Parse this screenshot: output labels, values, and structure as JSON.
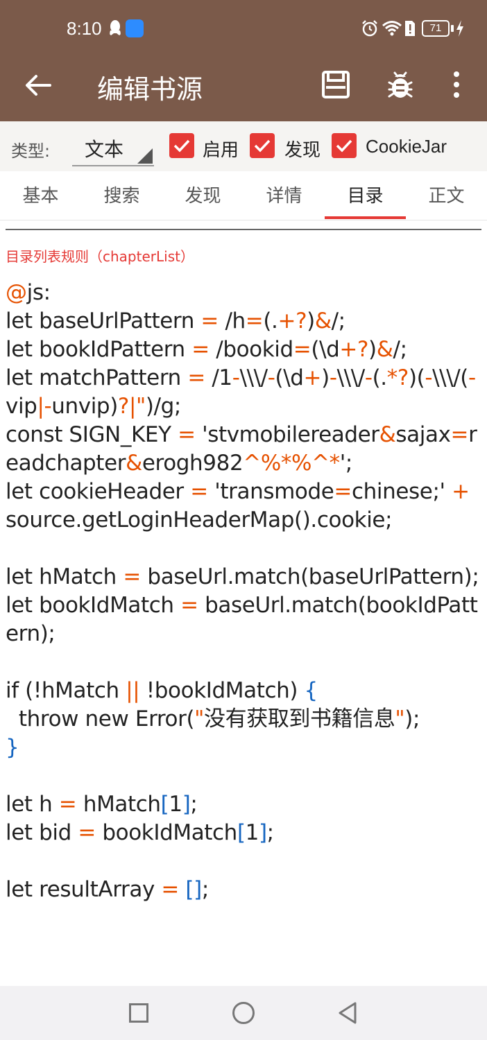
{
  "status_bar": {
    "time": "8:10",
    "battery": "71"
  },
  "toolbar": {
    "title": "编辑书源"
  },
  "type_row": {
    "label": "类型:",
    "selected": "文本",
    "checkboxes": [
      {
        "label": "启用",
        "checked": true
      },
      {
        "label": "发现",
        "checked": true
      },
      {
        "label": "CookieJar",
        "checked": true
      }
    ]
  },
  "tabs": [
    "基本",
    "搜索",
    "发现",
    "详情",
    "目录",
    "正文"
  ],
  "active_tab": "目录",
  "field": {
    "label": "目录列表规则（chapterList）"
  },
  "code_lines": [
    "@js:",
    "let baseUrlPattern = /h=(.+?)&/;",
    "let bookIdPattern = /bookid=(\\d+?)&/;",
    "let matchPattern = /1-\\\\\\/-(\\d+)-\\\\\\/-(.*?)(-\\\\\\/(-vip|-unvip)?|\")/g;",
    "const SIGN_KEY = 'stvmobilereader&sajax=readchapter&erogh982^%*%^*';",
    "let cookieHeader = 'transmode=chinese;' + source.getLoginHeaderMap().cookie;",
    "",
    "let hMatch = baseUrl.match(baseUrlPattern);",
    "let bookIdMatch = baseUrl.match(bookIdPattern);",
    "",
    "if (!hMatch || !bookIdMatch) {",
    "  throw new Error(\"没有获取到书籍信息\");",
    "}",
    "",
    "let h = hMatch[1];",
    "let bid = bookIdMatch[1];",
    "",
    "let resultArray = [];"
  ],
  "colors": {
    "app_bar": "#7b5a4a",
    "accent": "#e53935",
    "operator": "#e65100",
    "bracket": "#1565c0"
  }
}
